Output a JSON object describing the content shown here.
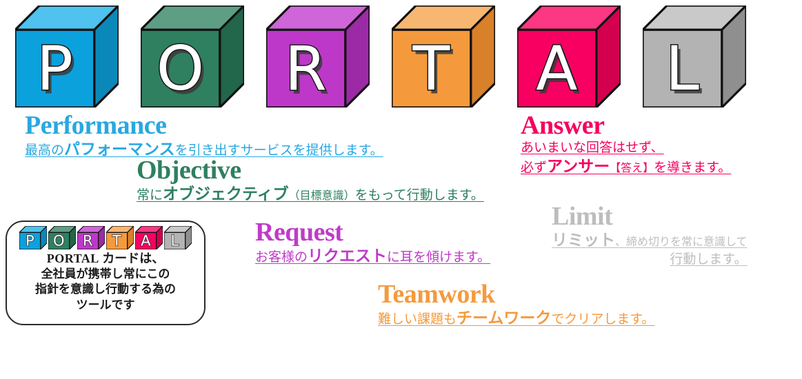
{
  "cubes": [
    {
      "letter": "P",
      "name": "cube-p",
      "front": "#0ba1dd",
      "top": "#4fc2ef",
      "side": "#0a88ba"
    },
    {
      "letter": "O",
      "name": "cube-o",
      "front": "#2e8060",
      "top": "#5d9e85",
      "side": "#22664b"
    },
    {
      "letter": "R",
      "name": "cube-r",
      "front": "#bd38c8",
      "top": "#cf65d8",
      "side": "#9c2aa6"
    },
    {
      "letter": "T",
      "name": "cube-t",
      "front": "#f59a3c",
      "top": "#f8b771",
      "side": "#d9802a"
    },
    {
      "letter": "A",
      "name": "cube-a",
      "front": "#f70062",
      "top": "#fc3784",
      "side": "#d2004f"
    },
    {
      "letter": "L",
      "name": "cube-l",
      "front": "#b3b3b3",
      "top": "#c9c9c9",
      "side": "#8f8f8f"
    }
  ],
  "words": [
    {
      "id": "performance",
      "en": "Performance",
      "color": "#29a8e0",
      "ja_plain_1": "最高の",
      "ja_em": "パフォーマンス",
      "ja_plain_2": "を引き出すサービスを提供します。"
    },
    {
      "id": "objective",
      "en": "Objective",
      "color": "#2e8060",
      "ja_plain_1": "常に",
      "ja_em": "オブジェクティブ",
      "ja_small": "（目標意識）",
      "ja_plain_2": "をもって行動します。"
    },
    {
      "id": "request",
      "en": "Request",
      "color": "#c03ac8",
      "ja_plain_1": "お客様の",
      "ja_em": "リクエスト",
      "ja_plain_2": "に耳を傾けます。"
    },
    {
      "id": "teamwork",
      "en": "Teamwork",
      "color": "#f59a3c",
      "ja_plain_1": "難しい課題も",
      "ja_em": "チームワーク",
      "ja_plain_2": "でクリアします。"
    },
    {
      "id": "answer",
      "en": "Answer",
      "color": "#f5005f",
      "ja_line1": "あいまいな回答はせず、",
      "ja_plain_1": "必ず",
      "ja_em": "アンサー",
      "ja_small": "【答え】",
      "ja_plain_2": "を導きます。"
    },
    {
      "id": "limit",
      "en": "Limit",
      "color": "#bdbdbd",
      "ja_em": "リミット",
      "ja_small": "、締め切りを常に意識して",
      "ja_line2": "行動します。"
    }
  ],
  "card": {
    "mini_cubes": [
      {
        "letter": "P",
        "front": "#0ba1dd",
        "top": "#4fc2ef",
        "side": "#0a88ba"
      },
      {
        "letter": "O",
        "front": "#2e8060",
        "top": "#5d9e85",
        "side": "#22664b"
      },
      {
        "letter": "R",
        "front": "#bd38c8",
        "top": "#cf65d8",
        "side": "#9c2aa6"
      },
      {
        "letter": "T",
        "front": "#f59a3c",
        "top": "#f8b771",
        "side": "#d9802a"
      },
      {
        "letter": "A",
        "front": "#f70062",
        "top": "#fc3784",
        "side": "#d2004f"
      },
      {
        "letter": "L",
        "front": "#b3b3b3",
        "top": "#c9c9c9",
        "side": "#8f8f8f"
      }
    ],
    "line1_en": "PORTAL",
    "line1_ja": "カードは、",
    "line2": "全社員が携帯し常にこの",
    "line3": "指針を意識し行動する為の",
    "line4": "ツールです"
  }
}
